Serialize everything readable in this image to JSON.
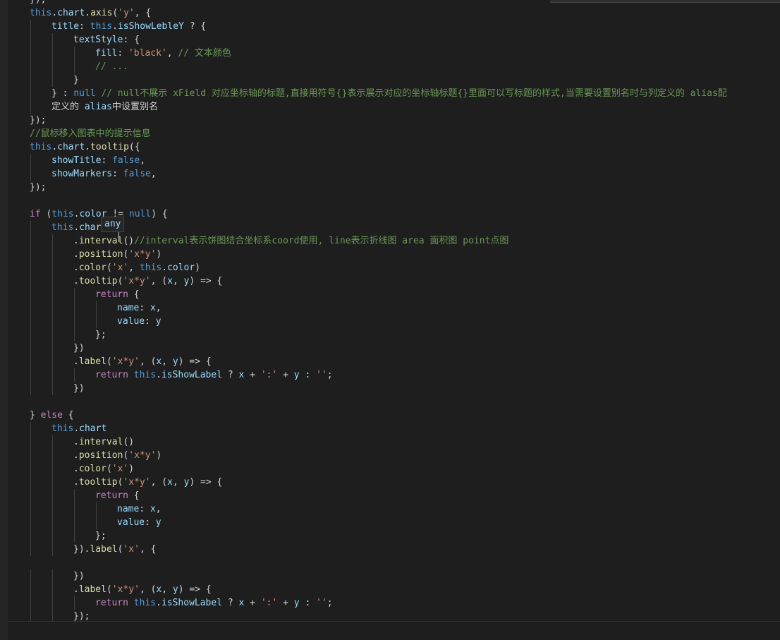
{
  "hover": {
    "type_label": "any"
  },
  "code_lines": [
    {
      "indent": 1,
      "text": "});"
    },
    {
      "indent": 1,
      "text": "this.chart.axis('y', {"
    },
    {
      "indent": 2,
      "text": "title: this.isShowLebleY ? {"
    },
    {
      "indent": 3,
      "text": "textStyle: {"
    },
    {
      "indent": 4,
      "text": "fill: 'black', // 文本颜色"
    },
    {
      "indent": 4,
      "text": "// ..."
    },
    {
      "indent": 3,
      "text": "}"
    },
    {
      "indent": 2,
      "text": "} : null // null不展示 xField 对应坐标轴的标题,直接用符号{}表示展示对应的坐标轴标题{}里面可以写标题的样式,当需要设置别名时与列定义的 alias配"
    },
    {
      "indent": 2,
      "text": "定义的 alias中设置别名"
    },
    {
      "indent": 1,
      "text": "});"
    },
    {
      "indent": 1,
      "text": "//鼠标移入图表中的提示信息"
    },
    {
      "indent": 1,
      "text": "this.chart.tooltip({"
    },
    {
      "indent": 2,
      "text": "showTitle: false,"
    },
    {
      "indent": 2,
      "text": "showMarkers: false,"
    },
    {
      "indent": 1,
      "text": "});"
    },
    {
      "indent": 1,
      "text": ""
    },
    {
      "indent": 1,
      "text": "if (this.color != null) {"
    },
    {
      "indent": 2,
      "text": "this.chart"
    },
    {
      "indent": 3,
      "text": ".interval()//interval表示饼图结合坐标系coord使用, line表示折线图 area 面积图 point点图"
    },
    {
      "indent": 3,
      "text": ".position('x*y')"
    },
    {
      "indent": 3,
      "text": ".color('x', this.color)"
    },
    {
      "indent": 3,
      "text": ".tooltip('x*y', (x, y) => {"
    },
    {
      "indent": 4,
      "text": "return {"
    },
    {
      "indent": 5,
      "text": "name: x,"
    },
    {
      "indent": 5,
      "text": "value: y"
    },
    {
      "indent": 4,
      "text": "};"
    },
    {
      "indent": 3,
      "text": "})"
    },
    {
      "indent": 3,
      "text": ".label('x*y', (x, y) => {"
    },
    {
      "indent": 4,
      "text": "return this.isShowLabel ? x + ':' + y : '';"
    },
    {
      "indent": 3,
      "text": "})"
    },
    {
      "indent": 1,
      "text": ""
    },
    {
      "indent": 1,
      "text": "} else {"
    },
    {
      "indent": 2,
      "text": "this.chart"
    },
    {
      "indent": 3,
      "text": ".interval()"
    },
    {
      "indent": 3,
      "text": ".position('x*y')"
    },
    {
      "indent": 3,
      "text": ".color('x')"
    },
    {
      "indent": 3,
      "text": ".tooltip('x*y', (x, y) => {"
    },
    {
      "indent": 4,
      "text": "return {"
    },
    {
      "indent": 5,
      "text": "name: x,"
    },
    {
      "indent": 5,
      "text": "value: y"
    },
    {
      "indent": 4,
      "text": "};"
    },
    {
      "indent": 3,
      "text": "}).label('x', {"
    },
    {
      "indent": 1,
      "text": ""
    },
    {
      "indent": 3,
      "text": "})"
    },
    {
      "indent": 3,
      "text": ".label('x*y', (x, y) => {"
    },
    {
      "indent": 4,
      "text": "return this.isShowLabel ? x + ':' + y : '';"
    },
    {
      "indent": 3,
      "text": "});"
    },
    {
      "indent": 1,
      "text": "}"
    }
  ]
}
